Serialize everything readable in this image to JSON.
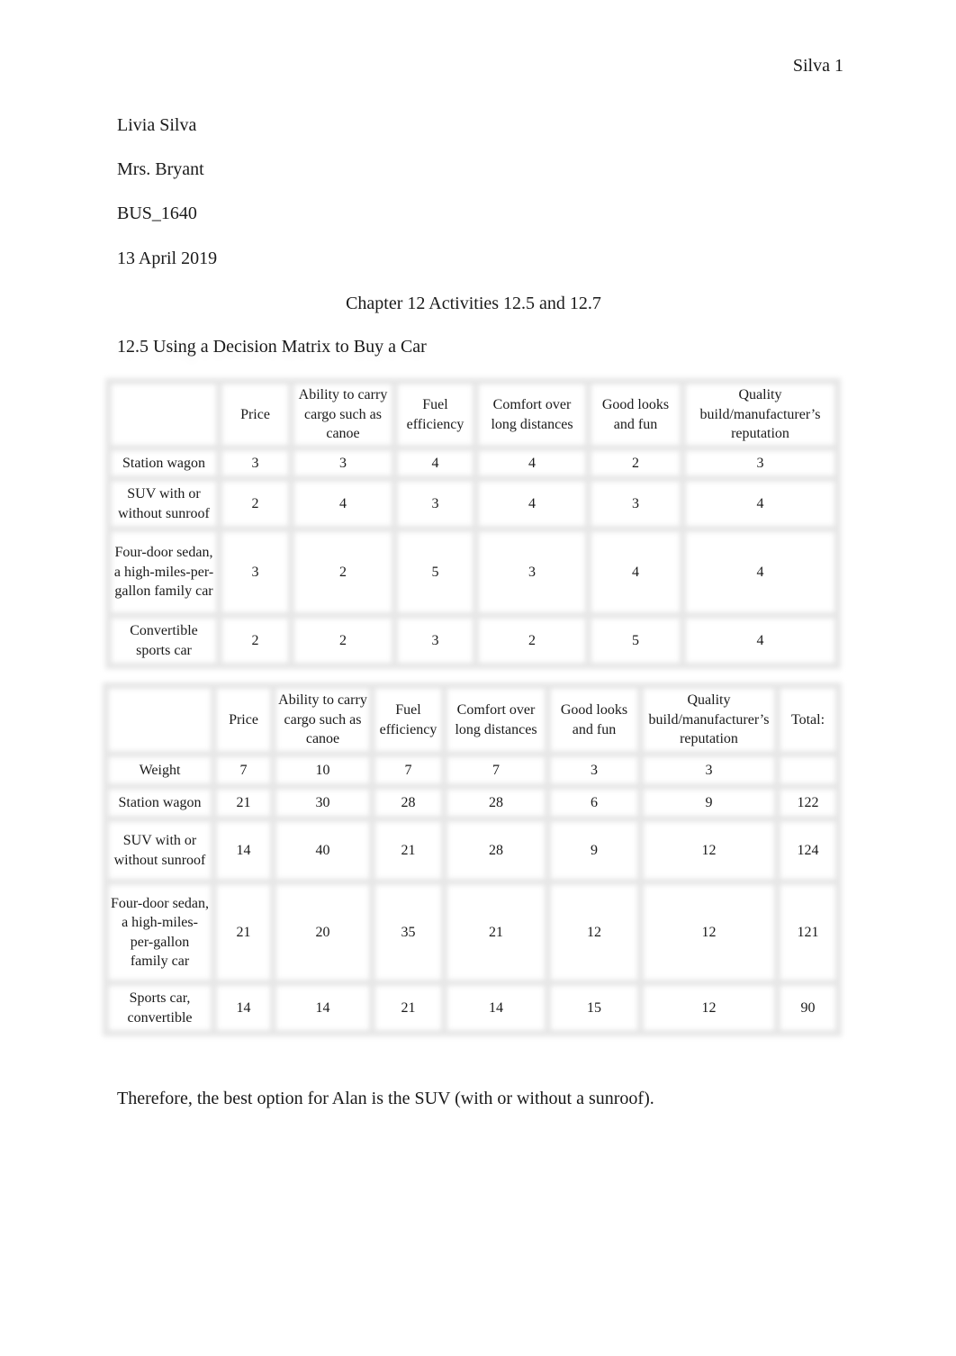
{
  "header": {
    "page_label": "Silva 1"
  },
  "student_info": {
    "name": "Livia Silva",
    "instructor": "Mrs. Bryant",
    "course": "BUS_1640",
    "date": "13 April 2019"
  },
  "title": "Chapter 12 Activities 12.5 and 12.7",
  "section_heading": "12.5 Using a Decision Matrix to Buy a Car",
  "table1": {
    "headers": [
      "",
      "Price",
      "Ability to carry cargo such as canoe",
      "Fuel efficiency",
      "Comfort over long distances",
      "Good looks and fun",
      "Quality build/manufacturer’s reputation"
    ],
    "rows": [
      [
        "Station wagon",
        "3",
        "3",
        "4",
        "4",
        "2",
        "3"
      ],
      [
        "SUV with or without sunroof",
        "2",
        "4",
        "3",
        "4",
        "3",
        "4"
      ],
      [
        "Four-door sedan, a high-miles-per-gallon family car",
        "3",
        "2",
        "5",
        "3",
        "4",
        "4"
      ],
      [
        "Convertible sports car",
        "2",
        "2",
        "3",
        "2",
        "5",
        "4"
      ]
    ]
  },
  "table2": {
    "headers": [
      "",
      "Price",
      "Ability to carry cargo such as canoe",
      "Fuel efficiency",
      "Comfort over long distances",
      "Good looks and fun",
      "Quality build/manufacturer’s reputation",
      "Total:"
    ],
    "rows": [
      [
        "Weight",
        "7",
        "10",
        "7",
        "7",
        "3",
        "3",
        ""
      ],
      [
        "Station wagon",
        "21",
        "30",
        "28",
        "28",
        "6",
        "9",
        "122"
      ],
      [
        "SUV with or without sunroof",
        "14",
        "40",
        "21",
        "28",
        "9",
        "12",
        "124"
      ],
      [
        "Four-door sedan, a high-miles-per-gallon family car",
        "21",
        "20",
        "35",
        "21",
        "12",
        "12",
        "121"
      ],
      [
        "Sports car, convertible",
        "14",
        "14",
        "21",
        "14",
        "15",
        "12",
        "90"
      ]
    ]
  },
  "conclusion": "Therefore, the best option for Alan is the SUV (with or without a sunroof)."
}
